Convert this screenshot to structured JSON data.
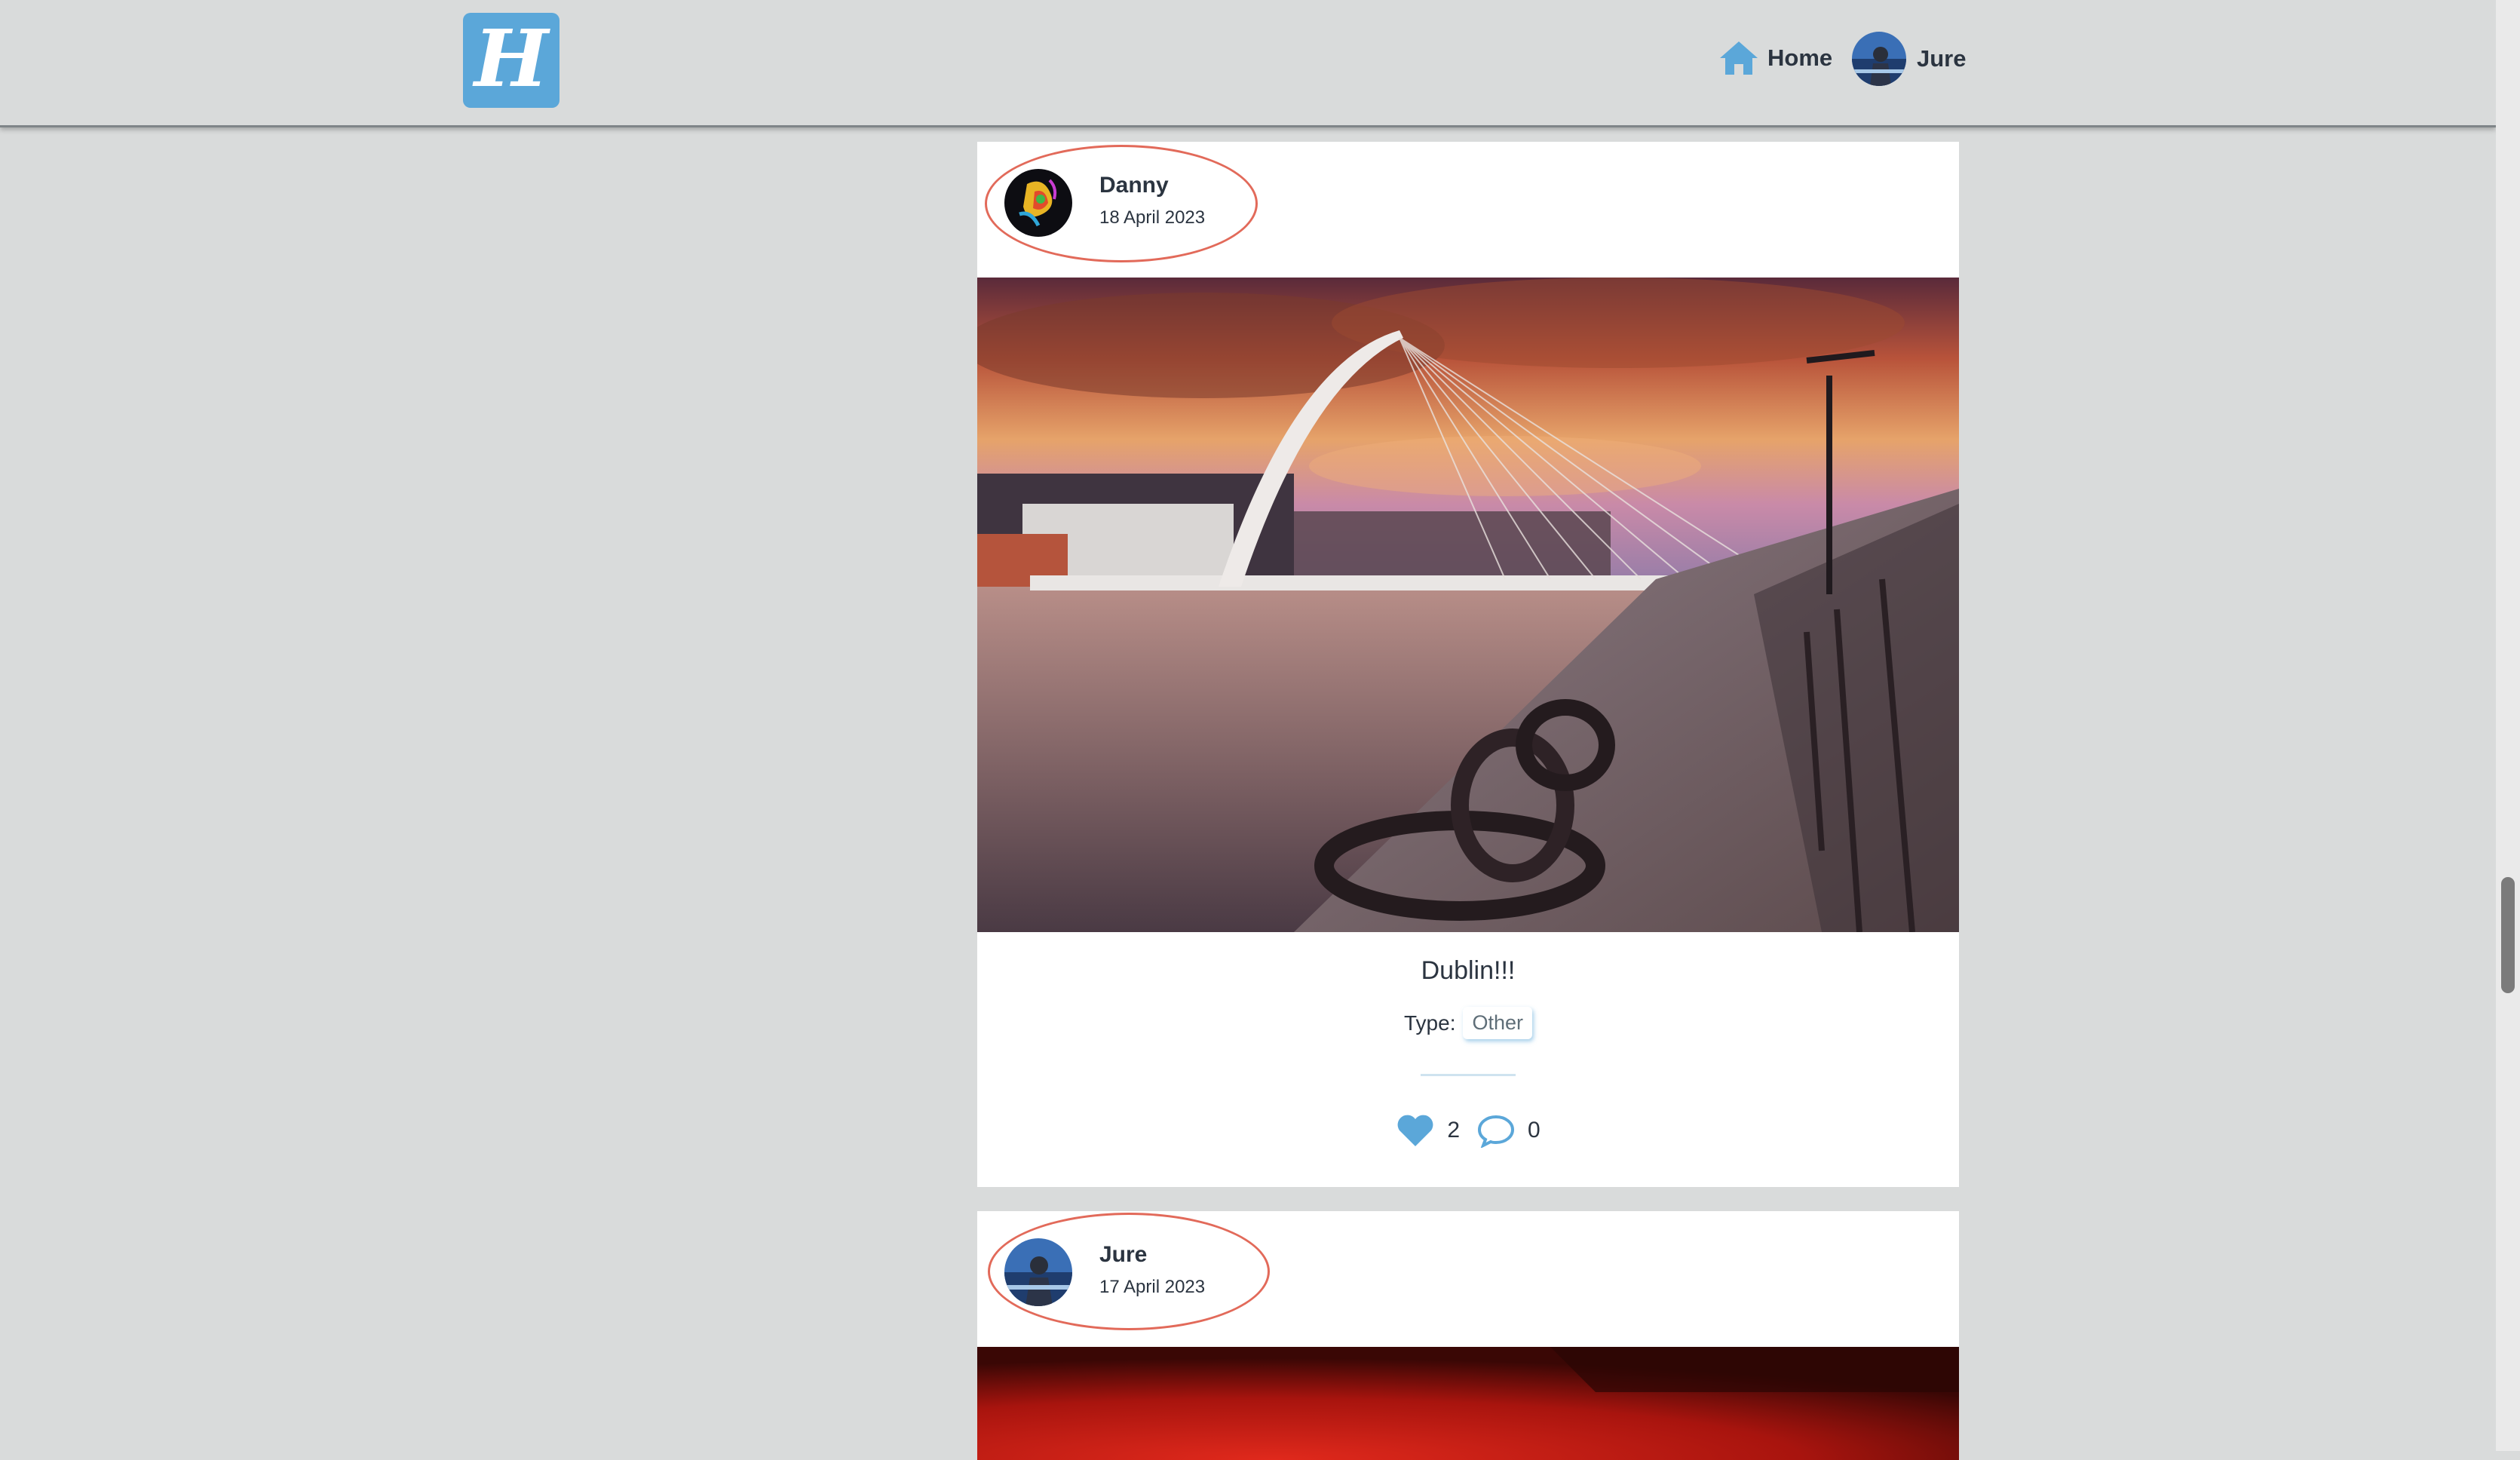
{
  "header": {
    "logo_letter": "H",
    "nav": {
      "home_label": "Home",
      "user_label": "Jure"
    }
  },
  "posts": [
    {
      "author": "Danny",
      "date": "18 April 2023",
      "title": "Dublin!!!",
      "type_label": "Type:",
      "type_value": "Other",
      "likes": "2",
      "comments": "0",
      "image": "sunset-bridge-river-photo"
    },
    {
      "author": "Jure",
      "date": "17 April 2023",
      "image": "red-room-photo"
    }
  ],
  "colors": {
    "accent": "#5ba7d9",
    "background": "#d9dbdb",
    "annotation": "#e26a5a",
    "text": "#2b3440"
  },
  "icons": {
    "home": "home-icon",
    "like": "heart-icon",
    "comment": "comment-icon"
  }
}
